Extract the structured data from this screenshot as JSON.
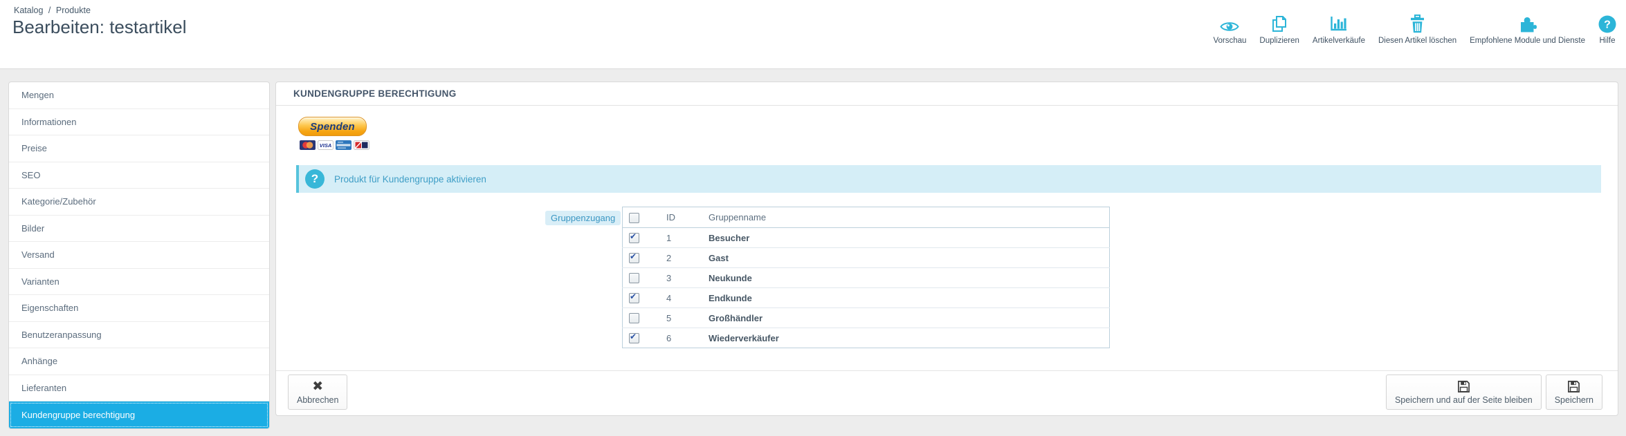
{
  "breadcrumb": {
    "items": [
      "Katalog",
      "Produkte"
    ],
    "separator": "/"
  },
  "page": {
    "title": "Bearbeiten: testartikel"
  },
  "header_actions": [
    {
      "label": "Vorschau",
      "icon": "eye-icon"
    },
    {
      "label": "Duplizieren",
      "icon": "duplicate-icon"
    },
    {
      "label": "Artikelverkäufe",
      "icon": "bar-chart-icon"
    },
    {
      "label": "Diesen Artikel löschen",
      "icon": "trash-icon"
    },
    {
      "label": "Empfohlene Module und Dienste",
      "icon": "puzzle-icon"
    },
    {
      "label": "Hilfe",
      "icon": "help-icon"
    }
  ],
  "sidebar": {
    "items": [
      {
        "label": "Mengen",
        "active": false
      },
      {
        "label": "Informationen",
        "active": false
      },
      {
        "label": "Preise",
        "active": false
      },
      {
        "label": "SEO",
        "active": false
      },
      {
        "label": "Kategorie/Zubehör",
        "active": false
      },
      {
        "label": "Bilder",
        "active": false
      },
      {
        "label": "Versand",
        "active": false
      },
      {
        "label": "Varianten",
        "active": false
      },
      {
        "label": "Eigenschaften",
        "active": false
      },
      {
        "label": "Benutzeranpassung",
        "active": false
      },
      {
        "label": "Anhänge",
        "active": false
      },
      {
        "label": "Lieferanten",
        "active": false
      },
      {
        "label": "Kundengruppe berechtigung",
        "active": true
      }
    ]
  },
  "panel": {
    "title": "KUNDENGRUPPE BERECHTIGUNG",
    "donate": {
      "button_label": "Spenden",
      "cards": [
        "mastercard",
        "visa",
        "amex",
        "ec"
      ]
    },
    "info": {
      "text": "Produkt für Kundengruppe aktivieren"
    },
    "form_label": "Gruppenzugang",
    "table": {
      "header_checked": false,
      "columns": {
        "id": "ID",
        "name": "Gruppenname"
      },
      "rows": [
        {
          "checked": true,
          "id": "1",
          "name": "Besucher"
        },
        {
          "checked": true,
          "id": "2",
          "name": "Gast"
        },
        {
          "checked": false,
          "id": "3",
          "name": "Neukunde"
        },
        {
          "checked": true,
          "id": "4",
          "name": "Endkunde"
        },
        {
          "checked": false,
          "id": "5",
          "name": "Großhändler"
        },
        {
          "checked": true,
          "id": "6",
          "name": "Wiederverkäufer"
        }
      ]
    },
    "footer": {
      "cancel_label": "Abbrechen",
      "save_stay_label": "Speichern und auf der Seite bleiben",
      "save_label": "Speichern"
    }
  },
  "colors": {
    "accent": "#2cb5d8",
    "selected_item": "#1bade4",
    "info_bg": "#d5eef7",
    "info_text": "#3f9ec6",
    "paypal_orange": "#f6a411",
    "paypal_text": "#1b3d7c"
  }
}
